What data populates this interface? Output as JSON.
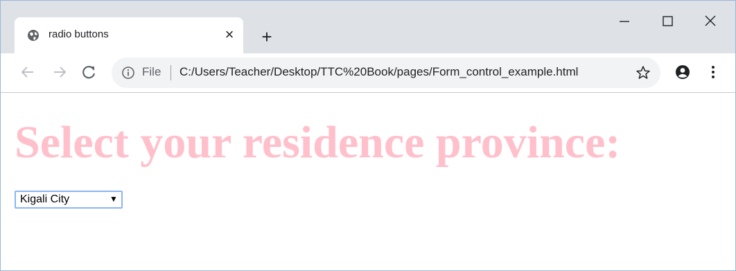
{
  "tab": {
    "title": "radio buttons",
    "close": "×"
  },
  "new_tab": "+",
  "address": {
    "scheme_label": "File",
    "url": "C:/Users/Teacher/Desktop/TTC%20Book/pages/Form_control_example.html"
  },
  "page": {
    "heading": "Select your residence province:",
    "select": {
      "value": "Kigali City",
      "arrow": "▼"
    }
  },
  "icons": [
    "globe-icon",
    "close-icon",
    "plus-icon",
    "minimize-icon",
    "maximize-icon",
    "close-window-icon",
    "back-arrow-icon",
    "forward-arrow-icon",
    "reload-icon",
    "info-icon",
    "star-icon",
    "profile-icon",
    "menu-dots-icon"
  ],
  "colors": {
    "heading": "#ffc0cb",
    "tabstrip": "#dee1e6",
    "omnibox": "#f1f3f4",
    "select_border": "#8ab4f8"
  }
}
